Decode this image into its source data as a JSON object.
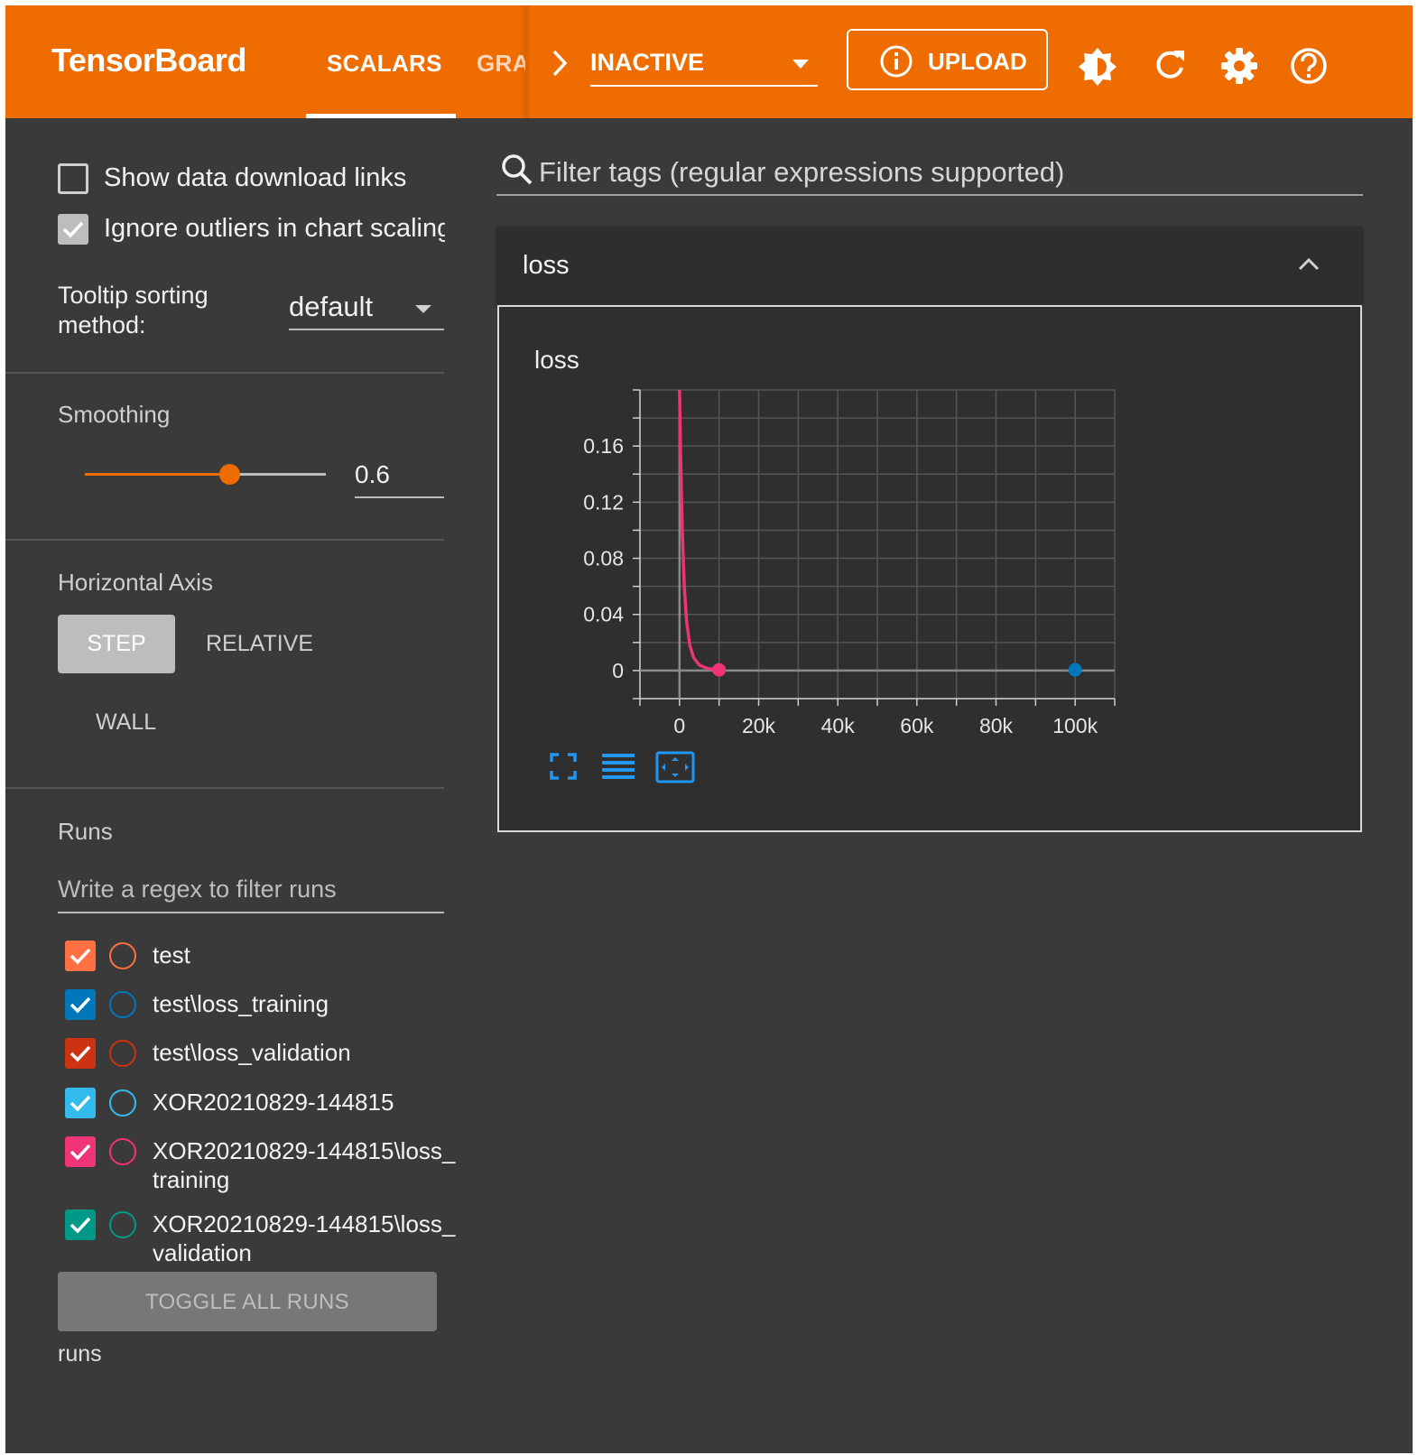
{
  "header": {
    "brand": "TensorBoard",
    "tabs": [
      {
        "label": "SCALARS",
        "active": true
      },
      {
        "label": "GRAPHS",
        "active": false
      }
    ],
    "status_select": {
      "value": "INACTIVE"
    },
    "upload_label": "UPLOAD",
    "icons": [
      "info-icon",
      "theme-toggle-icon",
      "reload-icon",
      "settings-icon",
      "help-icon"
    ],
    "color": "#ef6c00"
  },
  "sidebar": {
    "show_download_links": {
      "label": "Show data download links",
      "checked": false
    },
    "ignore_outliers": {
      "label": "Ignore outliers in chart scaling",
      "checked": true
    },
    "tooltip_sorting": {
      "label_line1": "Tooltip sorting",
      "label_line2": "method:",
      "value": "default"
    },
    "smoothing": {
      "title": "Smoothing",
      "value": "0.6",
      "level": 0.6
    },
    "horizontal_axis": {
      "title": "Horizontal Axis",
      "options": [
        "STEP",
        "RELATIVE",
        "WALL"
      ],
      "selected": "STEP"
    },
    "runs": {
      "title": "Runs",
      "filter_placeholder": "Write a regex to filter runs",
      "items": [
        {
          "label_line1": "test",
          "label_line2": "",
          "checked": true,
          "color": "#ff7043"
        },
        {
          "label_line1": "test\\loss_training",
          "label_line2": "",
          "checked": true,
          "color": "#0077bb"
        },
        {
          "label_line1": "test\\loss_validation",
          "label_line2": "",
          "checked": true,
          "color": "#cc3311"
        },
        {
          "label_line1": "XOR20210829-144815",
          "label_line2": "",
          "checked": true,
          "color": "#33bbee"
        },
        {
          "label_line1": "XOR20210829-144815\\loss_",
          "label_line2": "training",
          "checked": true,
          "color": "#ee3377"
        },
        {
          "label_line1": "XOR20210829-144815\\loss_",
          "label_line2": "validation",
          "checked": true,
          "color": "#009988"
        }
      ],
      "toggle_all_label": "TOGGLE ALL RUNS",
      "footer": "runs"
    }
  },
  "main": {
    "filter_placeholder": "Filter tags (regular expressions supported)",
    "card": {
      "title": "loss",
      "chart_title": "loss"
    },
    "chart_controls": [
      "fullscreen-icon",
      "log-scale-icon",
      "fit-domain-icon"
    ]
  },
  "chart_data": {
    "type": "line",
    "title": "loss",
    "xlabel": "",
    "ylabel": "",
    "xlim": [
      -10000,
      110000
    ],
    "ylim": [
      -0.02,
      0.2
    ],
    "x_ticks": [
      "0",
      "20k",
      "40k",
      "60k",
      "80k",
      "100k"
    ],
    "x_tick_values": [
      0,
      20000,
      40000,
      60000,
      80000,
      100000
    ],
    "y_ticks": [
      "0",
      "0.04",
      "0.08",
      "0.12",
      "0.16"
    ],
    "y_tick_values": [
      0,
      0.04,
      0.08,
      0.12,
      0.16
    ],
    "grid": true,
    "series": [
      {
        "color": "#ee3377",
        "x": [
          0,
          300,
          700,
          1200,
          1800,
          2600,
          3600,
          5000,
          7000,
          10000
        ],
        "y": [
          0.2,
          0.15,
          0.1,
          0.06,
          0.035,
          0.018,
          0.009,
          0.004,
          0.0015,
          0.0005
        ],
        "marker": {
          "x": 10000,
          "y": 0.0005
        }
      },
      {
        "color": "#0077bb",
        "x": [
          100000
        ],
        "y": [
          0.0005
        ],
        "marker": {
          "x": 100000,
          "y": 0.0005
        }
      }
    ]
  }
}
